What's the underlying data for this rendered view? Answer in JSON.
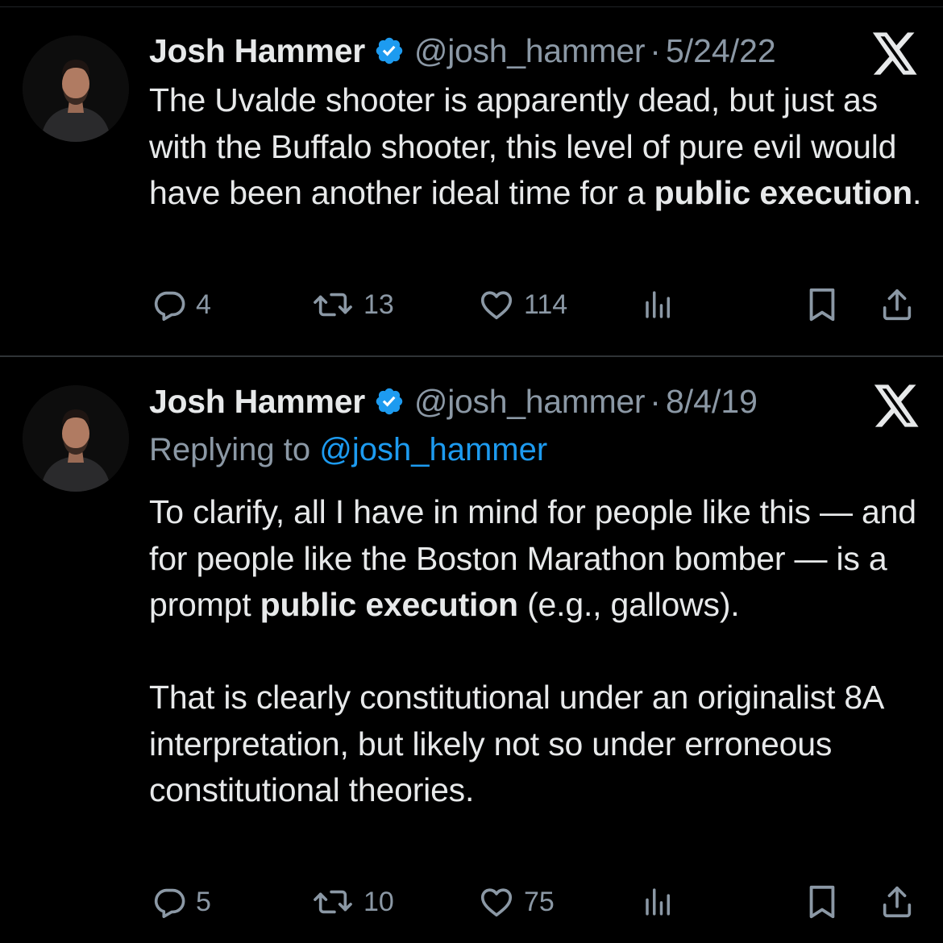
{
  "tweets": [
    {
      "author_name": "Josh Hammer",
      "handle": "@josh_hammer",
      "separator": "·",
      "date": "5/24/22",
      "verified": true,
      "reply_prefix": "",
      "reply_to": "",
      "text_segments": [
        {
          "t": "The Uvalde shooter is apparently dead, but just as with the Buffalo shooter, this level of pure evil would have been another ideal time for a ",
          "bold": false
        },
        {
          "t": "public execution",
          "bold": true
        },
        {
          "t": ".",
          "bold": false
        }
      ],
      "counts": {
        "replies": "4",
        "reposts": "13",
        "likes": "114"
      }
    },
    {
      "author_name": "Josh Hammer",
      "handle": "@josh_hammer",
      "separator": "·",
      "date": "8/4/19",
      "verified": true,
      "reply_prefix": "Replying to",
      "reply_to": "@josh_hammer",
      "paragraph1_segments": [
        {
          "t": "To clarify, all I have in mind for people like this — and for people like the Boston Marathon bomber — is a prompt ",
          "bold": false
        },
        {
          "t": "public execution",
          "bold": true
        },
        {
          "t": " (e.g., gallows).",
          "bold": false
        }
      ],
      "paragraph2": "That is clearly constitutional under an originalist 8A interpretation, but likely not so under erroneous constitutional theories.",
      "counts": {
        "replies": "5",
        "reposts": "10",
        "likes": "75"
      }
    }
  ],
  "icons": {
    "platform_logo": "x-logo-icon",
    "verified_badge": "verified-badge-icon",
    "reply": "reply-icon",
    "repost": "repost-icon",
    "like": "heart-icon",
    "views": "views-icon",
    "bookmark": "bookmark-icon",
    "share": "share-icon"
  },
  "colors": {
    "background": "#000000",
    "text_primary": "#e7e9ea",
    "text_secondary": "#8b98a5",
    "link": "#1d9bf0",
    "verified": "#1d9bf0",
    "divider": "#2f3336"
  }
}
